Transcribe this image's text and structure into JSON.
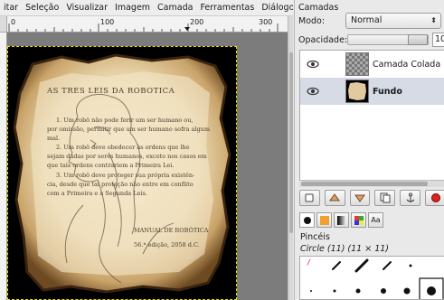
{
  "menubar": {
    "items": [
      "itar",
      "Seleção",
      "Visualizar",
      "Imagem",
      "Camada",
      "Ferramentas",
      "Diálogos"
    ]
  },
  "ruler": {
    "ticks": [
      "0",
      "100",
      "200",
      "300"
    ]
  },
  "canvas": {
    "page": {
      "title": "AS TRES LEIS DA ROBOTICA",
      "lines": [
        "1. Um robô não pode ferir um ser humano ou,",
        "por omissão, permitir que um ser humano sofra algum",
        "mal.",
        "2. Um robô deve obedecer às ordens que lhe",
        "sejam dadas por seres humanos, exceto nos casos em",
        "que tais ordens contrariem a Primeira Lei.",
        "3. Um robô deve proteger sua própria existên-",
        "cia, desde que tal proteção não entre em conflito",
        "com a Primeira e a Segunda Leis."
      ],
      "footer1": "MANUAL DE ROBÓTICA",
      "footer2": "56.ª edição, 2058 d.C."
    }
  },
  "dock": {
    "title": "Camadas",
    "mode_label": "Modo:",
    "mode_value": "Normal",
    "opacity_label": "Opacidade:",
    "opacity_value": "10",
    "layers": [
      {
        "name": "Camada Colada",
        "selected": false
      },
      {
        "name": "Fundo",
        "selected": true
      }
    ],
    "brushes_title": "Pincéis",
    "brush_info": "Circle (11) (11 × 11)",
    "tab_text_label": "Aa"
  }
}
